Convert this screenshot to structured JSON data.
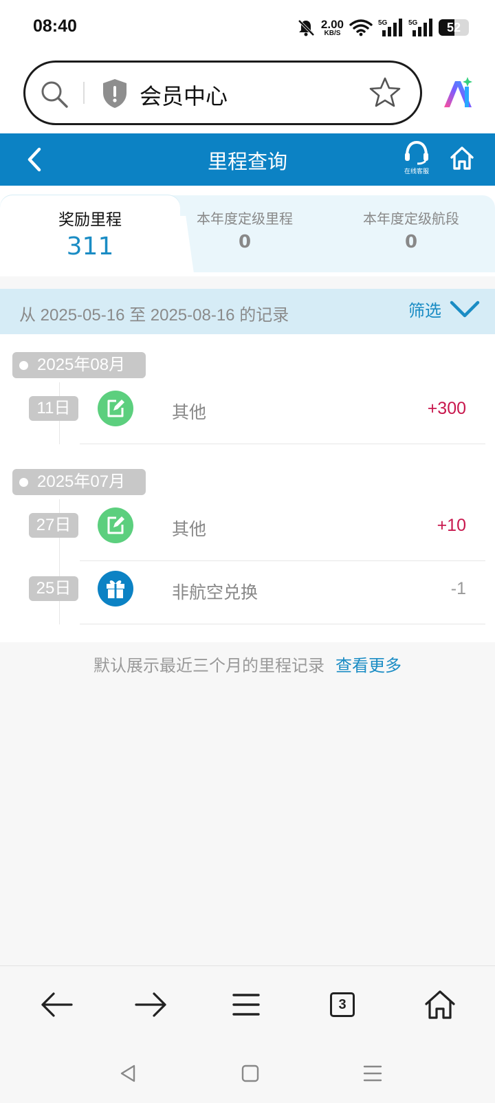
{
  "status_bar": {
    "time": "08:40",
    "net_speed_value": "2.00",
    "net_speed_unit": "KB/S",
    "battery": "52",
    "icons": [
      "mute-bell-icon",
      "wifi-icon",
      "signal-5g-icon",
      "signal-5g-icon",
      "battery-icon"
    ]
  },
  "browser": {
    "url_title": "会员中心",
    "icons": [
      "search-icon",
      "shield-icon",
      "star-icon",
      "ai-icon"
    ]
  },
  "header": {
    "title": "里程查询",
    "service_label": "在线客服",
    "icons": [
      "back-icon",
      "headset-icon",
      "home-icon"
    ],
    "color": "#0c82c4"
  },
  "summary": {
    "tabs": [
      {
        "label": "奖励里程",
        "value": "311"
      },
      {
        "label": "本年度定级里程",
        "value": "0"
      },
      {
        "label": "本年度定级航段",
        "value": "0"
      }
    ]
  },
  "range": {
    "text": "从 2025-05-16 至 2025-08-16 的记录",
    "filter_label": "筛选"
  },
  "records": {
    "groups": [
      {
        "month": "2025年08月",
        "items": [
          {
            "day": "11日",
            "icon": "edit-icon",
            "type": "其他",
            "amount": "+300"
          }
        ]
      },
      {
        "month": "2025年07月",
        "items": [
          {
            "day": "27日",
            "icon": "edit-icon",
            "type": "其他",
            "amount": "+10"
          },
          {
            "day": "25日",
            "icon": "gift-icon",
            "type": "非航空兑换",
            "amount": "-1"
          }
        ]
      }
    ]
  },
  "note": {
    "text": "默认展示最近三个月的里程记录",
    "link": "查看更多"
  },
  "browser_nav": {
    "tab_count": "3",
    "icons": [
      "back-arrow-icon",
      "forward-arrow-icon",
      "menu-icon",
      "tabs-icon",
      "home-icon"
    ]
  },
  "colors": {
    "accent": "#0c82c4",
    "positive": "#c8174d",
    "negative": "#999999",
    "record_icon_green": "#5ccf7e"
  }
}
